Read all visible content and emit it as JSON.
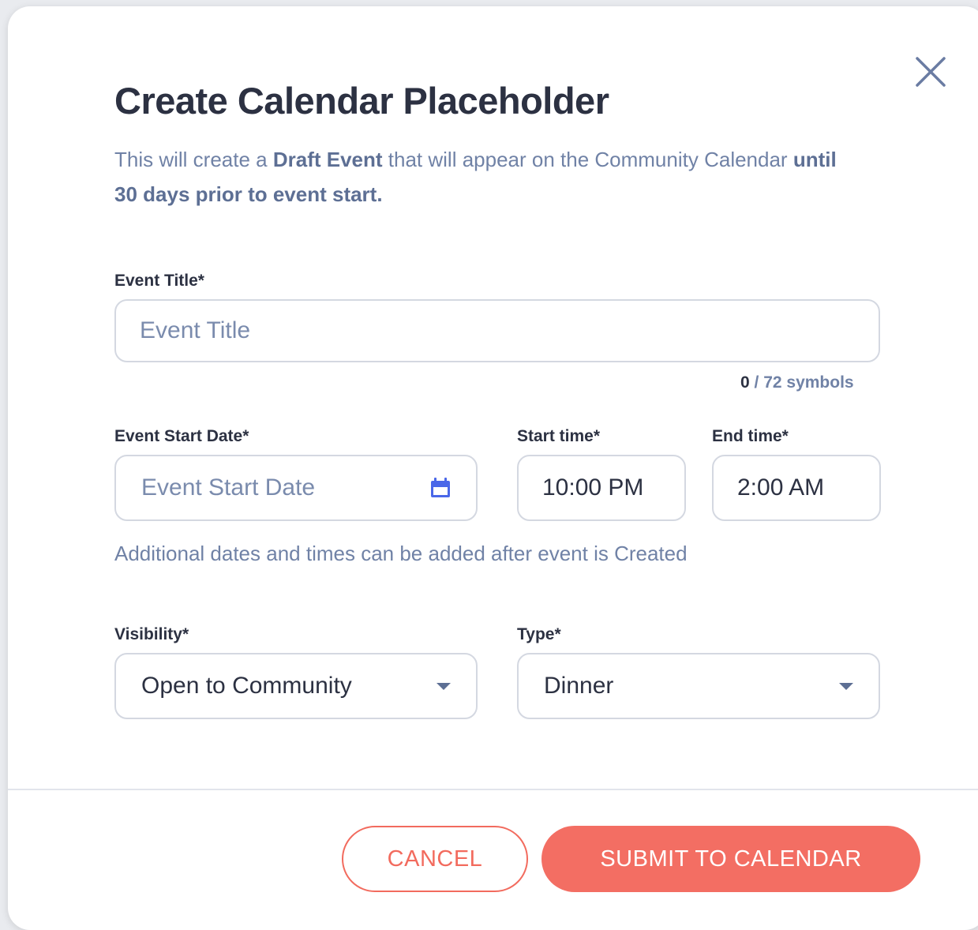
{
  "modal": {
    "title": "Create Calendar Placeholder",
    "subtitle": {
      "part1": "This will create a ",
      "bold1": "Draft Event",
      "part2": " that will appear on the Community Calendar ",
      "bold2": "until 30 days prior to event start."
    },
    "close_icon": "close-icon"
  },
  "form": {
    "event_title": {
      "label": "Event Title*",
      "placeholder": "Event Title",
      "value": ""
    },
    "counter": {
      "current": "0",
      "separator": " / ",
      "max_text": "72 symbols"
    },
    "start_date": {
      "label": "Event Start Date*",
      "placeholder": "Event Start Date",
      "icon": "calendar-icon"
    },
    "start_time": {
      "label": "Start time*",
      "value": "10:00 PM"
    },
    "end_time": {
      "label": "End time*",
      "value": "2:00 AM"
    },
    "hint": "Additional dates and times can be added after event is Created",
    "visibility": {
      "label": "Visibility*",
      "value": "Open to Community"
    },
    "type": {
      "label": "Type*",
      "value": "Dinner"
    }
  },
  "footer": {
    "cancel_label": "CANCEL",
    "submit_label": "SUBMIT TO CALENDAR"
  },
  "colors": {
    "accent": "#f36e63",
    "text_dark": "#2c3142",
    "text_muted": "#7082a6",
    "calendar_icon": "#4a67e8"
  }
}
